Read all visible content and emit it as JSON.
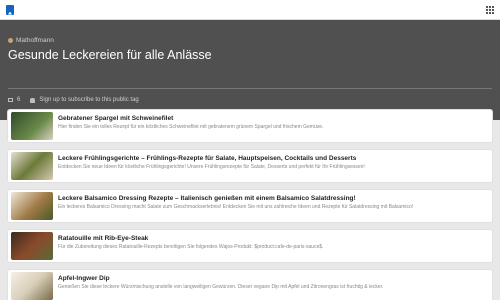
{
  "header": {
    "logo_icon": "bookmark-logo-icon",
    "apps_icon": "grid-icon"
  },
  "hero": {
    "author": "Mathoffmann",
    "title": "Gesunde Leckereien für alle Anlässe",
    "count": "6",
    "subscribe_text": "Sign up to subscribe to this public tag"
  },
  "items": [
    {
      "title": "Gebratener Spargel mit Schweinefilet",
      "description": "Hier finden Sie ein tolles Rezept für ein köstliches Schweinefilet mit gebratenem grünem Spargel und frischem Gemüse.",
      "thumb_color": "#3e5b34"
    },
    {
      "title": "Leckere Frühlingsgerichte – Frühlings-Rezepte für Salate, Hauptspeisen, Cocktails und Desserts",
      "description": "Entdecken Sie neue Ideen für köstliche Frühlingsgerichte! Unsere Frühlingsrezepte für Salate, Desserts und perfekt für Ihr Frühlingsessen!",
      "thumb_color": "#6b7a3a"
    },
    {
      "title": "Leckere Balsamico Dressing Rezepte – Italienisch genießen mit einem Balsamico Salatdressing!",
      "description": "Ein leckeres Balsamico Dressing macht Salate zum Geschmackserlebnis! Entdecken Sie mit uns zahlreiche Ideen und Rezepte für Salatdressing mit Balsamico!",
      "thumb_color": "#a07a46"
    },
    {
      "title": "Ratatouille mit Rib-Eye-Steak",
      "description": "Für die Zubereitung dieses Ratatouille-Rezepts benötigen Sie folgendes Wajos-Produkt: $product:cafe-de-paris-sauce$.",
      "thumb_color": "#5a3a2a"
    },
    {
      "title": "Apfel-Ingwer Dip",
      "description": "Genießen Sie diese leckere Würzmischung anstelle von langweiligen Gewürzen. Dieser vegane Dip mit Apfel und Zitronengras ist fruchtig & lecker.",
      "thumb_color": "#d8cfb8"
    }
  ]
}
